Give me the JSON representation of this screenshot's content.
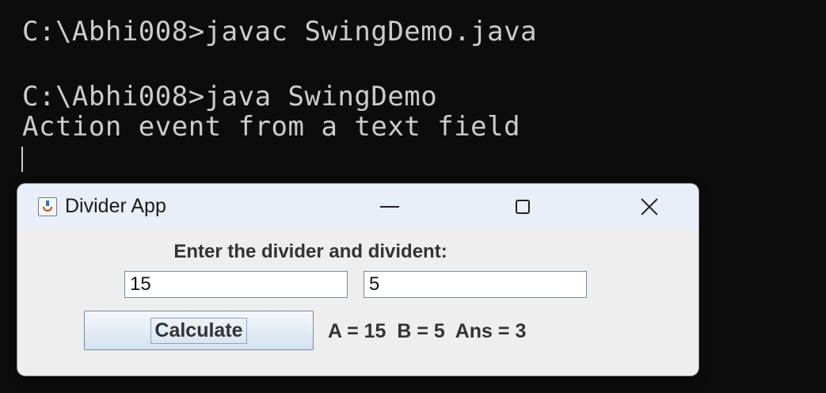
{
  "console": {
    "lines": [
      "C:\\Abhi008>javac SwingDemo.java",
      "C:\\Abhi008>java SwingDemo",
      "Action event from a text field"
    ]
  },
  "window": {
    "title": "Divider App",
    "icon": "java-cup-icon",
    "controls": {
      "minimize": "minimize-icon",
      "maximize": "maximize-icon",
      "close": "close-icon"
    }
  },
  "form": {
    "prompt": "Enter the divider and divident:",
    "divider_value": "15",
    "divident_value": "5",
    "calculate_label": "Calculate",
    "result": "A = 15  B = 5  Ans = 3"
  },
  "colors": {
    "console_bg": "#0c0c0c",
    "console_text": "#cccccc",
    "window_bg": "#eeeeee",
    "titlebar_bg": "#e9eff8"
  }
}
